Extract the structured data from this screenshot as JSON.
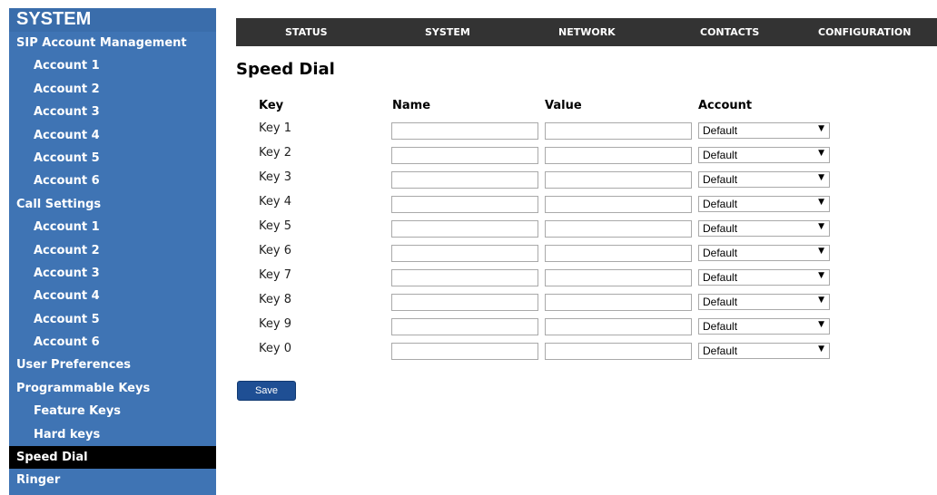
{
  "sidebar": {
    "title": "SYSTEM",
    "items": [
      {
        "label": "SIP Account Management",
        "level": 0,
        "active": false
      },
      {
        "label": "Account 1",
        "level": 1,
        "active": false
      },
      {
        "label": "Account 2",
        "level": 1,
        "active": false
      },
      {
        "label": "Account 3",
        "level": 1,
        "active": false
      },
      {
        "label": "Account 4",
        "level": 1,
        "active": false
      },
      {
        "label": "Account 5",
        "level": 1,
        "active": false
      },
      {
        "label": "Account 6",
        "level": 1,
        "active": false
      },
      {
        "label": "Call Settings",
        "level": 0,
        "active": false
      },
      {
        "label": "Account 1",
        "level": 1,
        "active": false
      },
      {
        "label": "Account 2",
        "level": 1,
        "active": false
      },
      {
        "label": "Account 3",
        "level": 1,
        "active": false
      },
      {
        "label": "Account 4",
        "level": 1,
        "active": false
      },
      {
        "label": "Account 5",
        "level": 1,
        "active": false
      },
      {
        "label": "Account 6",
        "level": 1,
        "active": false
      },
      {
        "label": "User Preferences",
        "level": 0,
        "active": false
      },
      {
        "label": "Programmable Keys",
        "level": 0,
        "active": false
      },
      {
        "label": "Feature Keys",
        "level": 1,
        "active": false
      },
      {
        "label": "Hard keys",
        "level": 1,
        "active": false
      },
      {
        "label": "Speed Dial",
        "level": 0,
        "active": true
      },
      {
        "label": "Ringer",
        "level": 0,
        "active": false
      }
    ]
  },
  "topnav": {
    "status": "STATUS",
    "system": "SYSTEM",
    "network": "NETWORK",
    "contacts": "CONTACTS",
    "configuration": "CONFIGURATION"
  },
  "page": {
    "title": "Speed Dial",
    "headers": {
      "key": "Key",
      "name": "Name",
      "value": "Value",
      "account": "Account"
    },
    "rows": [
      {
        "key": "Key 1",
        "name": "",
        "value": "",
        "account": "Default"
      },
      {
        "key": "Key 2",
        "name": "",
        "value": "",
        "account": "Default"
      },
      {
        "key": "Key 3",
        "name": "",
        "value": "",
        "account": "Default"
      },
      {
        "key": "Key 4",
        "name": "",
        "value": "",
        "account": "Default"
      },
      {
        "key": "Key 5",
        "name": "",
        "value": "",
        "account": "Default"
      },
      {
        "key": "Key 6",
        "name": "",
        "value": "",
        "account": "Default"
      },
      {
        "key": "Key 7",
        "name": "",
        "value": "",
        "account": "Default"
      },
      {
        "key": "Key 8",
        "name": "",
        "value": "",
        "account": "Default"
      },
      {
        "key": "Key 9",
        "name": "",
        "value": "",
        "account": "Default"
      },
      {
        "key": "Key 0",
        "name": "",
        "value": "",
        "account": "Default"
      }
    ],
    "save_label": "Save"
  },
  "colors": {
    "sidebar_bg": "#3f74b4",
    "sidebar_active_bg": "#000000",
    "topbar_bg": "#333333",
    "save_button_bg": "#1f4f94"
  }
}
